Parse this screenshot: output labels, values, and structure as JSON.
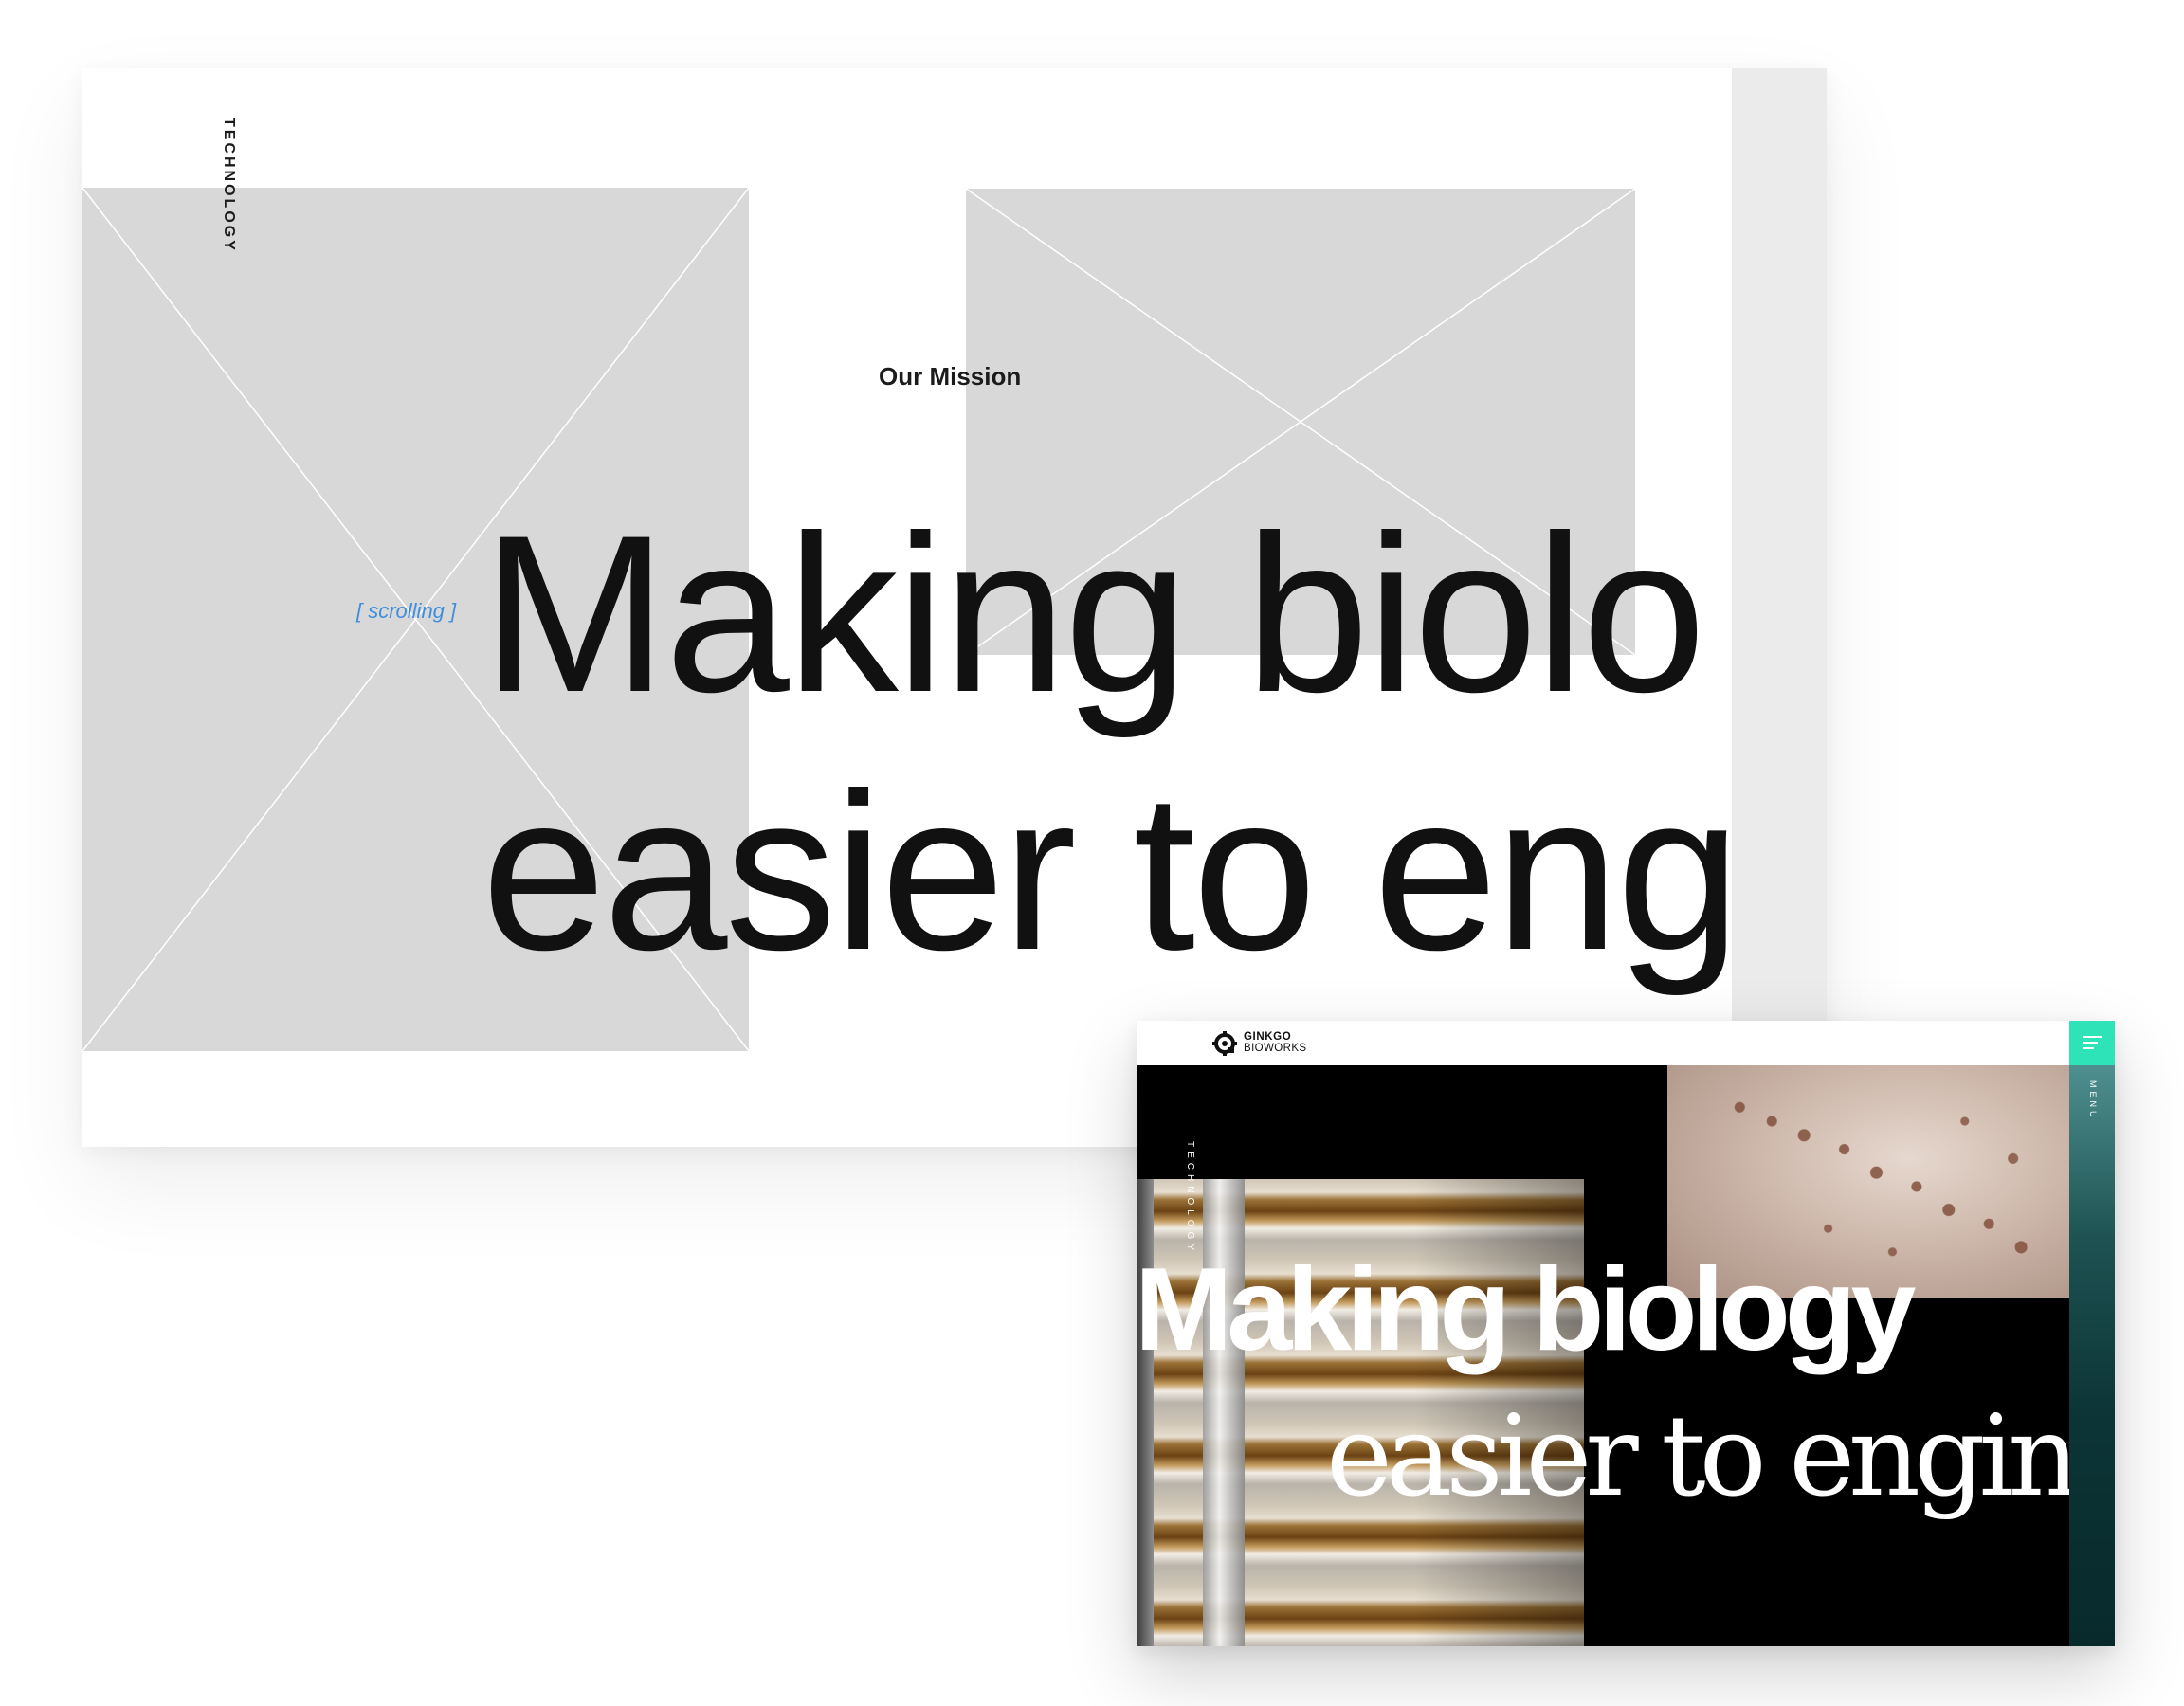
{
  "wireframe": {
    "vertical_label": "TECHNOLOGY",
    "section_title": "Our Mission",
    "scroll_hint": "[ scrolling ]",
    "headline_line1": "Making biolo",
    "headline_line2": "easier to eng",
    "placeholder_color": "#d8d8d8",
    "hint_color": "#3f8ede"
  },
  "site": {
    "logo_line1": "GINKGO",
    "logo_line2": "BIOWORKS",
    "menu_label": "MENU",
    "vertical_label": "TECHNOLOGY",
    "headline_line1": "Making biology",
    "headline_line2": "easier to engine",
    "accent_color": "#2fe3b8",
    "icons": [
      "ginkgo-logo-icon",
      "hamburger-menu-icon"
    ]
  }
}
